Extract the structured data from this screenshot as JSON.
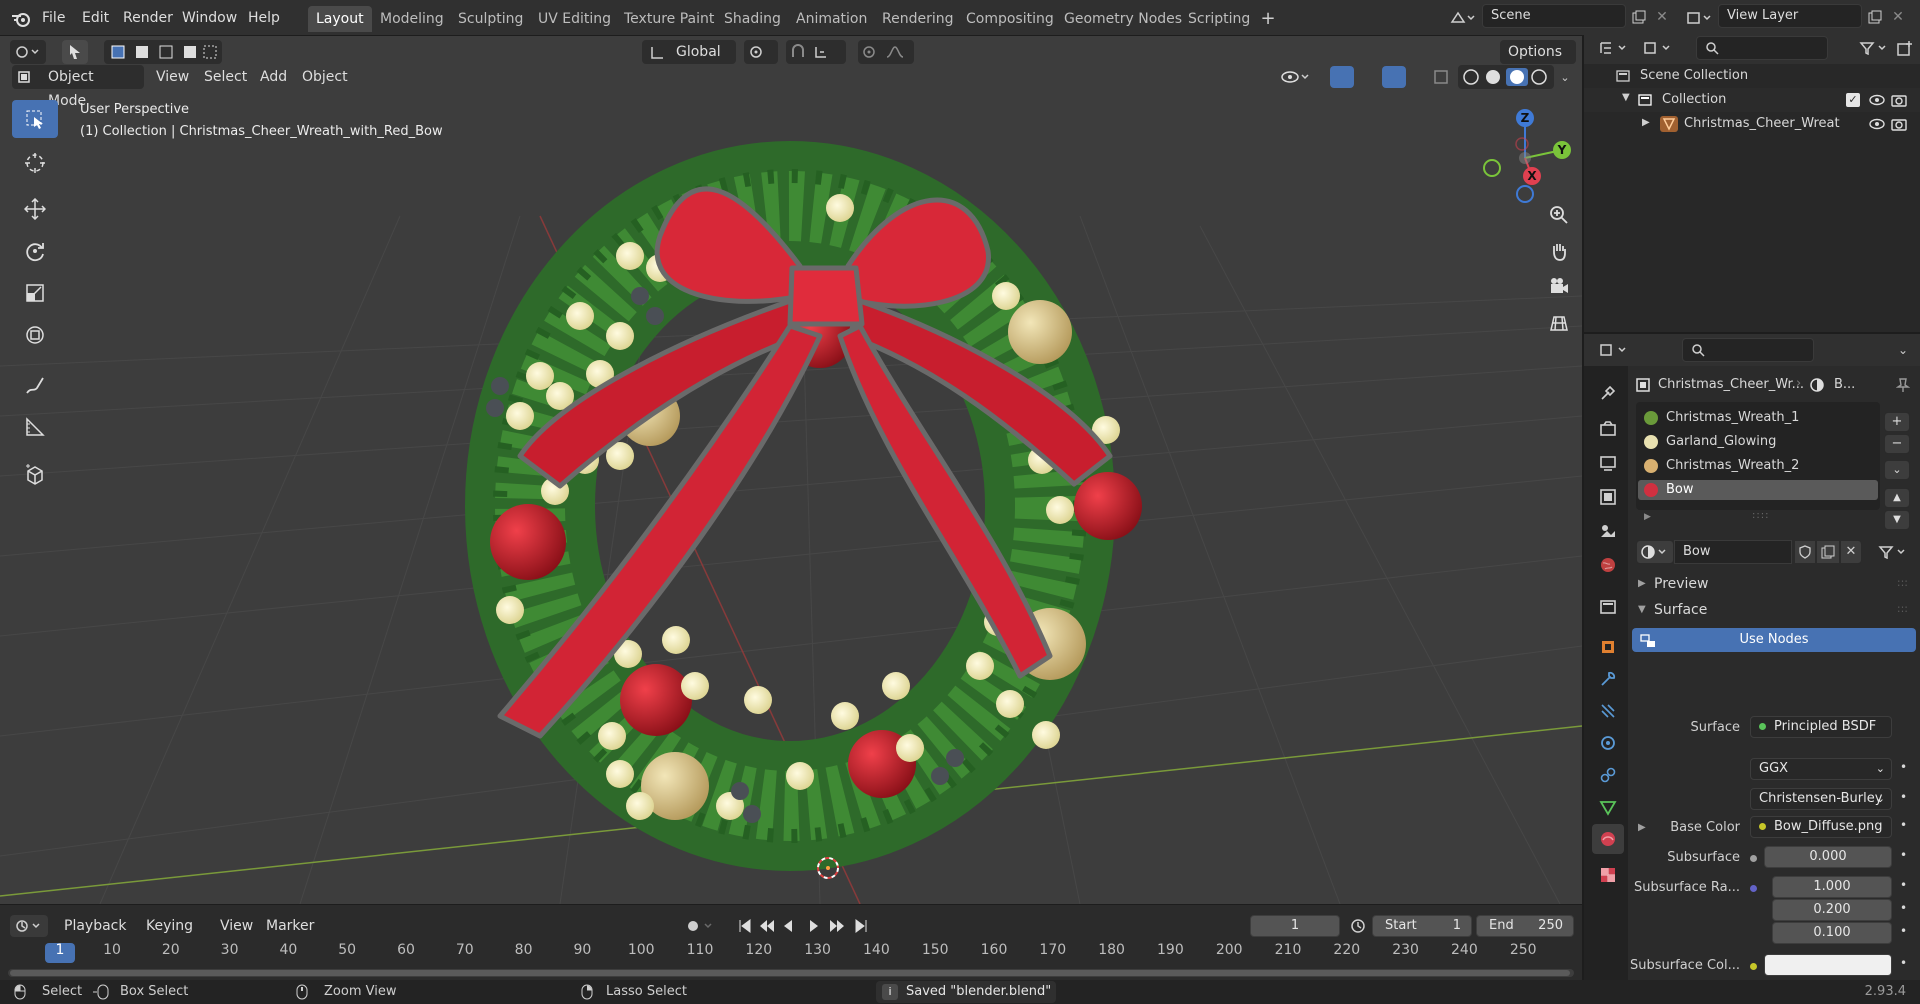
{
  "topbar": {
    "menu": [
      "File",
      "Edit",
      "Render",
      "Window",
      "Help"
    ],
    "workspaces": [
      "Layout",
      "Modeling",
      "Sculpting",
      "UV Editing",
      "Texture Paint",
      "Shading",
      "Animation",
      "Rendering",
      "Compositing",
      "Geometry Nodes",
      "Scripting"
    ],
    "active_workspace": "Layout",
    "scene_label": "Scene",
    "view_layer_label": "View Layer"
  },
  "viewport": {
    "transform_orientation": "Global",
    "options_label": "Options",
    "mode": "Object Mode",
    "header_menus": [
      "View",
      "Select",
      "Add",
      "Object"
    ],
    "overlay_line1": "User Perspective",
    "overlay_line2": "(1) Collection | Christmas_Cheer_Wreath_with_Red_Bow",
    "gizmo_axes": {
      "z": "Z",
      "y": "Y",
      "x": "X"
    }
  },
  "timeline": {
    "menus": [
      "Playback",
      "Keying",
      "View",
      "Marker"
    ],
    "current_frame": "1",
    "start_label": "Start",
    "start_value": "1",
    "end_label": "End",
    "end_value": "250",
    "ruler": [
      "1",
      "10",
      "20",
      "30",
      "40",
      "50",
      "60",
      "70",
      "80",
      "90",
      "100",
      "110",
      "120",
      "130",
      "140",
      "150",
      "160",
      "170",
      "180",
      "190",
      "200",
      "210",
      "220",
      "230",
      "240",
      "250"
    ]
  },
  "statusbar": {
    "select": "Select",
    "box_select": "Box Select",
    "zoom_view": "Zoom View",
    "lasso_select": "Lasso Select",
    "message": "Saved \"blender.blend\"",
    "version": "2.93.4"
  },
  "outliner": {
    "root": "Scene Collection",
    "collection": "Collection",
    "object": "Christmas_Cheer_Wreath"
  },
  "properties": {
    "object_name": "Christmas_Cheer_Wr...",
    "material_short": "B...",
    "material_slots": [
      {
        "name": "Christmas_Wreath_1",
        "color": "#6a9a3a"
      },
      {
        "name": "Garland_Glowing",
        "color": "#e8e0b0"
      },
      {
        "name": "Christmas_Wreath_2",
        "color": "#d8b070"
      },
      {
        "name": "Bow",
        "color": "#d03040"
      }
    ],
    "active_slot": "Bow",
    "material_name": "Bow",
    "panels": {
      "preview": "Preview",
      "surface": "Surface"
    },
    "use_nodes": "Use Nodes",
    "surface_label": "Surface",
    "surface_value": "Principled BSDF",
    "distribution": "GGX",
    "subsurface_method": "Christensen-Burley",
    "base_color_label": "Base Color",
    "base_color_value": "Bow_Diffuse.png",
    "subsurface_label": "Subsurface",
    "subsurface_value": "0.000",
    "subsurface_radius_label": "Subsurface Ra...",
    "subsurface_radius": [
      "1.000",
      "0.200",
      "0.100"
    ],
    "subsurface_color_label": "Subsurface Col..."
  }
}
